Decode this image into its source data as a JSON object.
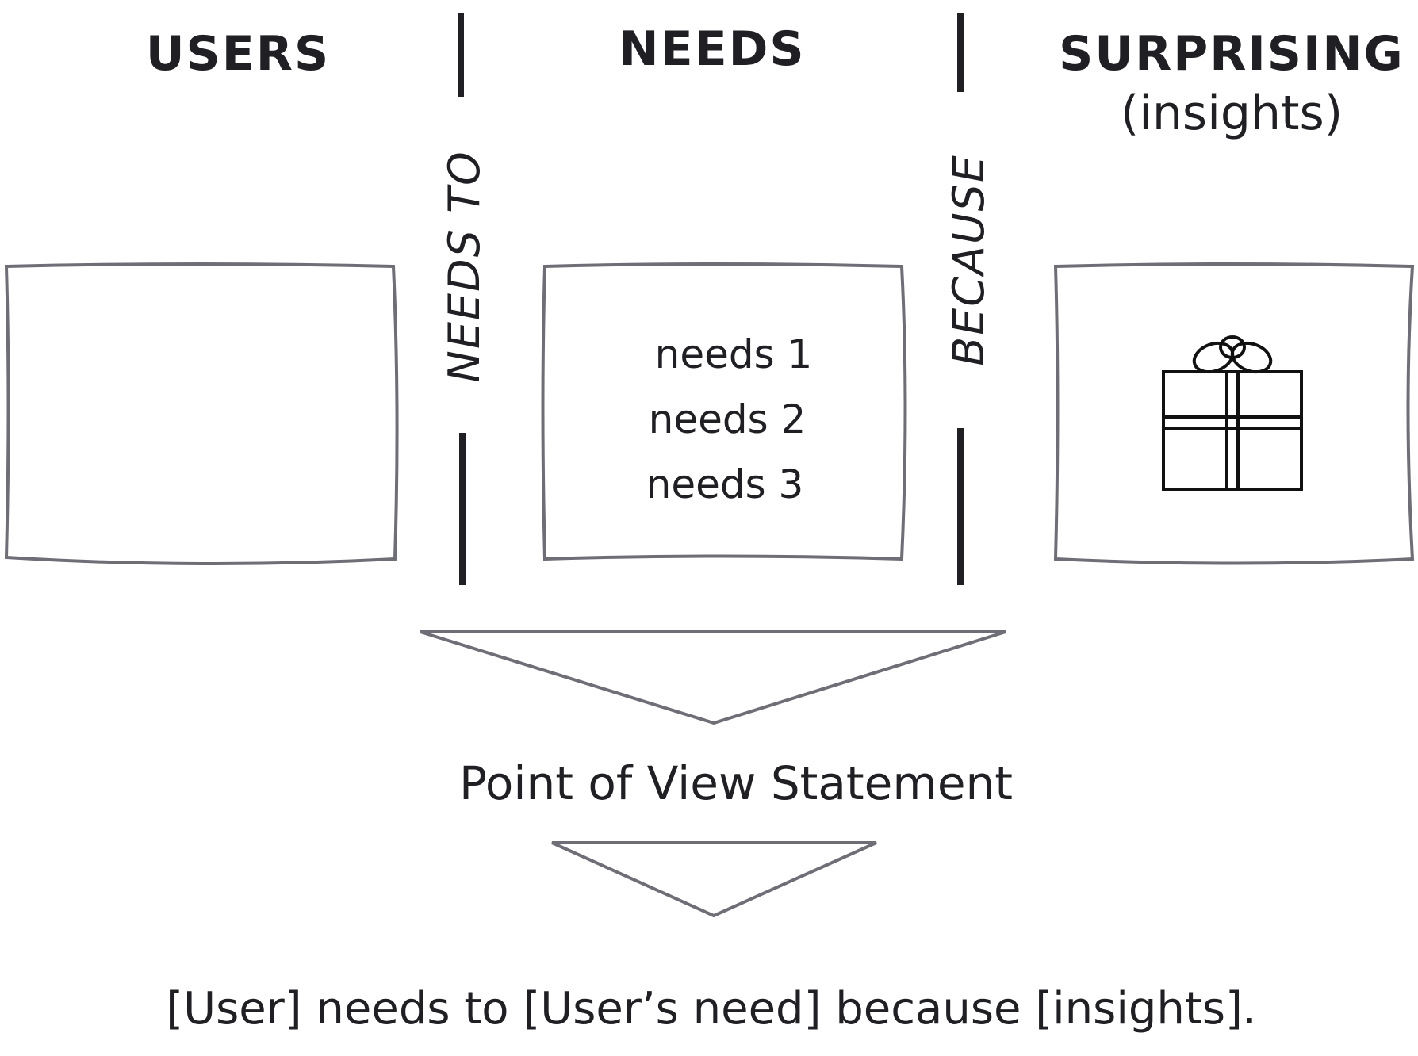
{
  "headers": {
    "users": "USERS",
    "needs": "NEEDS",
    "surprising": "SURPRISING",
    "insights_sub": "(insights)"
  },
  "connectors": {
    "needs_to": "NEEDS TO",
    "because": "BECAUSE"
  },
  "needs_box": {
    "items": [
      "needs 1",
      "needs 2",
      "needs 3"
    ]
  },
  "icons": {
    "insights_box_icon": "gift-icon"
  },
  "colors": {
    "text": "#1f1f24",
    "outline": "#6f6e77"
  },
  "statement": {
    "label": "Point of View Statement",
    "formula": "[User] needs to [User’s need] because [insights]."
  }
}
